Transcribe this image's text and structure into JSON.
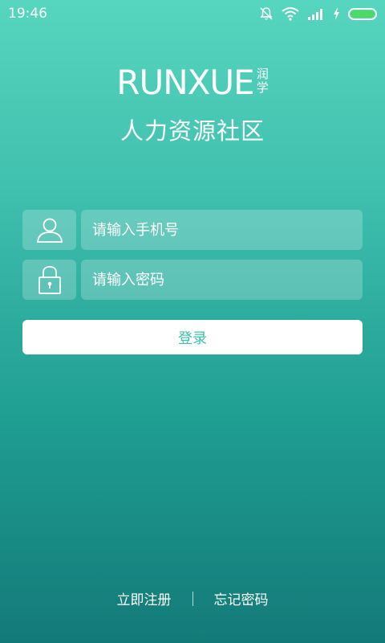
{
  "status_bar": {
    "time": "19:46",
    "icons": [
      "notification-off-icon",
      "wifi-icon",
      "signal-icon",
      "charging-icon",
      "battery-icon"
    ]
  },
  "brand": {
    "wordmark": "RUNXUE",
    "chinese_line1": "润",
    "chinese_line2": "学",
    "subtitle": "人力资源社区"
  },
  "form": {
    "phone_placeholder": "请输入手机号",
    "password_placeholder": "请输入密码",
    "login_label": "登录"
  },
  "links": {
    "register": "立即注册",
    "forgot": "忘记密码"
  },
  "colors": {
    "gradient_top": "#57d6be",
    "gradient_bottom": "#137a78",
    "button_text": "#3fc2ad",
    "battery": "#4cd964"
  }
}
